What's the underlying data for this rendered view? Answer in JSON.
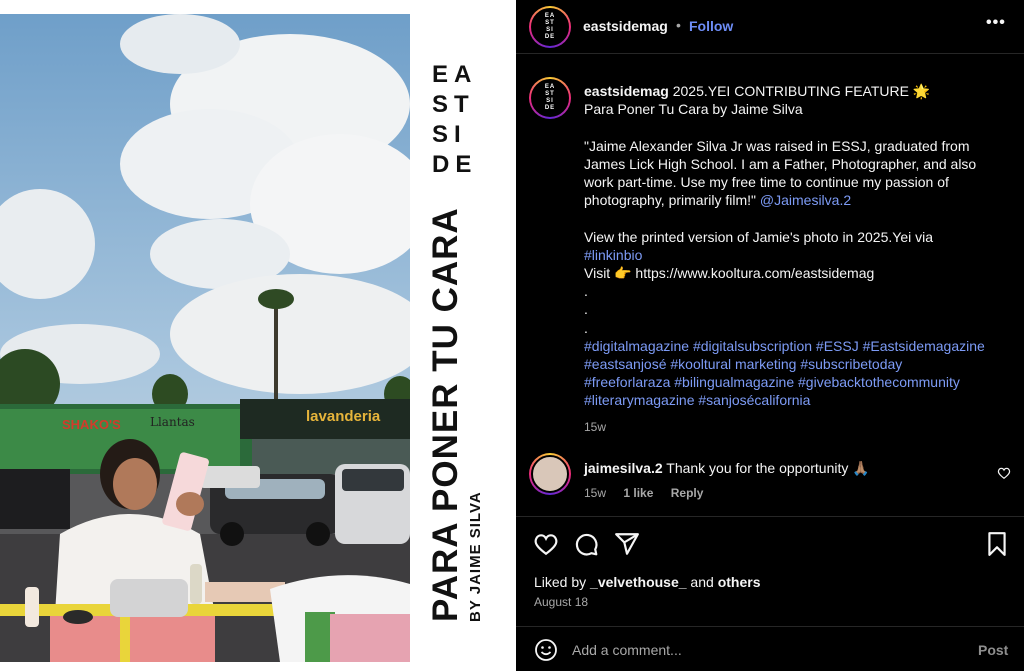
{
  "header": {
    "username": "eastsidemag",
    "dot": "•",
    "follow_label": "Follow",
    "more_label": "•••",
    "avatar_text": [
      "EA",
      "ST",
      "SI",
      "DE"
    ]
  },
  "media": {
    "logo_lines": [
      "EA",
      "ST",
      "SI",
      "DE"
    ],
    "title": "PARA PONER TU CARA",
    "byline": "BY JAIME SILVA",
    "sign_left": "SHAKO'S",
    "sign_mid": "Llantas",
    "sign_right": "lavanderia"
  },
  "caption": {
    "username": "eastsidemag",
    "line1_rest": " 2025.YEI CONTRIBUTING FEATURE 🌟",
    "line2": "Para Poner Tu Cara by Jaime Silva",
    "quote_lines": [
      "\"Jaime Alexander Silva Jr was raised in ESSJ, graduated from",
      "James Lick High School. I am a Father, Photographer, and also",
      "work part-time. Use my free time to continue my passion of"
    ],
    "quote_last": "photography, primarily film!\" ",
    "mention": "@Jaimesilva.2",
    "view_line": "View the printed version of Jamie's photo in 2025.Yei via",
    "hashtag_linkinbio": "#linkinbio",
    "visit_line": "Visit 👉 https://www.kooltura.com/eastsidemag",
    "dots": [
      ".",
      ".",
      "."
    ],
    "hashtag_lines": [
      "#digitalmagazine #digitalsubscription #ESSJ #Eastsidemagazine",
      "#eastsanjosé #kooltural marketing #subscribetoday",
      "#freeforlaraza #bilingualmagazine #givebacktothecommunity",
      "#literarymagazine #sanjosécalifornia"
    ],
    "time": "15w"
  },
  "comment": {
    "username": "jaimesilva.2",
    "text": " Thank you for the opportunity 🙏🏽",
    "time": "15w",
    "likes": "1 like",
    "reply": "Reply"
  },
  "actions": {
    "liked_prefix": "Liked by ",
    "liked_user": "_velvethouse_",
    "liked_middle": " and ",
    "liked_others": "others",
    "date": "August 18"
  },
  "add_comment": {
    "placeholder": "Add a comment...",
    "post_label": "Post"
  }
}
